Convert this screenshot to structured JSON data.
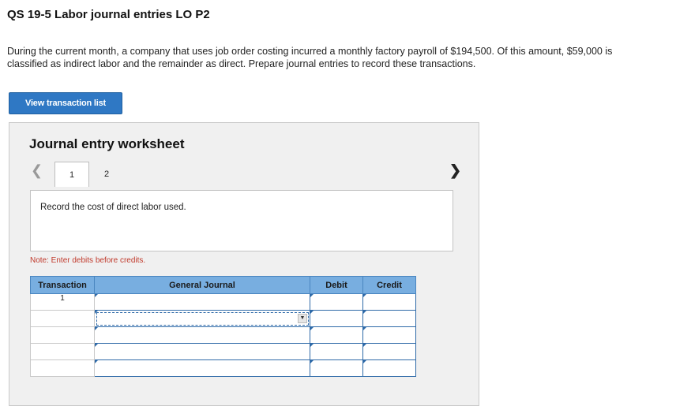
{
  "header": {
    "title": "QS 19-5 Labor journal entries LO P2"
  },
  "question": {
    "text": "During the current month, a company that uses job order costing incurred a monthly factory payroll of $194,500. Of this amount, $59,000 is classified as indirect labor and the remainder as direct. Prepare journal entries to record these transactions."
  },
  "actions": {
    "view_transactions_label": "View transaction list"
  },
  "worksheet": {
    "title": "Journal entry worksheet",
    "prev_icon": "chevron-left-icon",
    "next_icon": "chevron-right-icon",
    "tabs": [
      {
        "label": "1",
        "active": true
      },
      {
        "label": "2",
        "active": false
      }
    ],
    "instruction": "Record the cost of direct labor used.",
    "note": "Note: Enter debits before credits.",
    "columns": {
      "transaction": "Transaction",
      "general_journal": "General Journal",
      "debit": "Debit",
      "credit": "Credit"
    },
    "rows": [
      {
        "transaction": "1",
        "account": "",
        "debit": "",
        "credit": ""
      },
      {
        "transaction": "",
        "account": "",
        "debit": "",
        "credit": ""
      },
      {
        "transaction": "",
        "account": "",
        "debit": "",
        "credit": ""
      },
      {
        "transaction": "",
        "account": "",
        "debit": "",
        "credit": ""
      },
      {
        "transaction": "",
        "account": "",
        "debit": "",
        "credit": ""
      }
    ]
  },
  "colors": {
    "button_blue": "#2f78c4",
    "table_header": "#78aee0",
    "note_red": "#c0392b",
    "panel_bg": "#f0f0f0"
  }
}
